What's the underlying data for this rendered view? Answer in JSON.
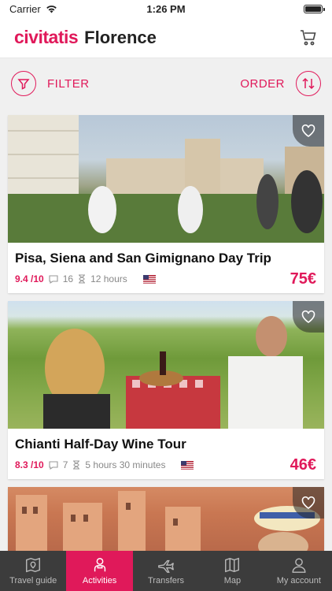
{
  "status": {
    "carrier": "Carrier",
    "time": "1:26 PM"
  },
  "header": {
    "brand": "civitatis",
    "city": "Florence"
  },
  "toolbar": {
    "filter_label": "FILTER",
    "order_label": "ORDER"
  },
  "activities": [
    {
      "title": "Pisa, Siena and San Gimignano Day Trip",
      "rating": "9.4 /10",
      "comments": "16",
      "duration": "12 hours",
      "price": "75€"
    },
    {
      "title": "Chianti Half-Day Wine Tour",
      "rating": "8.3 /10",
      "comments": "7",
      "duration": "5 hours 30 minutes",
      "price": "46€"
    }
  ],
  "tabs": [
    {
      "label": "Travel guide",
      "icon": "map-book-icon"
    },
    {
      "label": "Activities",
      "icon": "person-icon",
      "active": true
    },
    {
      "label": "Transfers",
      "icon": "plane-icon"
    },
    {
      "label": "Map",
      "icon": "map-icon"
    },
    {
      "label": "My account",
      "icon": "account-icon"
    }
  ],
  "colors": {
    "accent": "#e0195a",
    "tabbar": "#3c3c3c"
  }
}
